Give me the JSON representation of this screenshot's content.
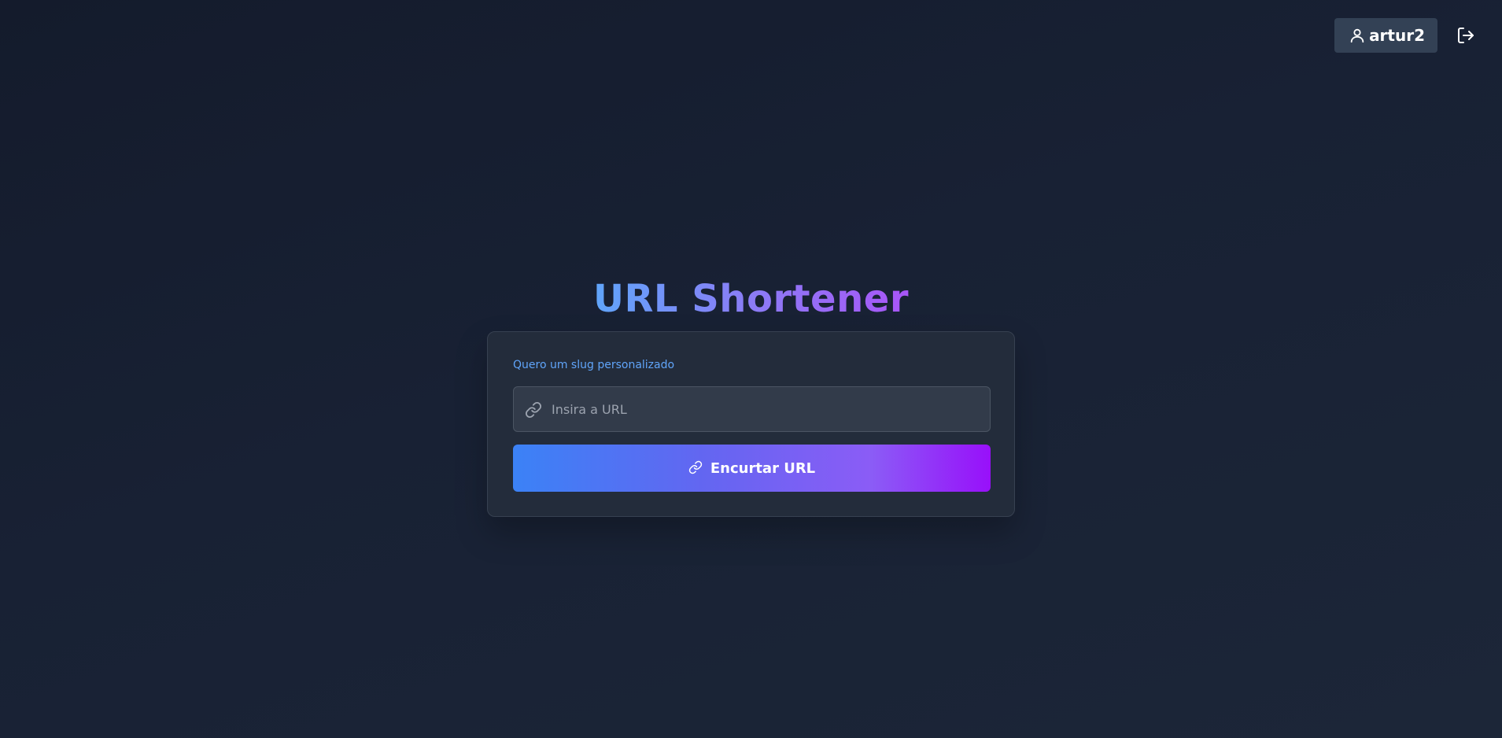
{
  "header": {
    "username": "artur2",
    "user_icon": "user-icon",
    "logout_icon": "logout-icon"
  },
  "main": {
    "title": "URL Shortener",
    "custom_slug_link": "Quero um slug personalizado",
    "url_input": {
      "value": "",
      "placeholder": "Insira a URL",
      "icon": "link-icon"
    },
    "submit_button": {
      "label": "Encurtar URL",
      "icon": "link-icon"
    }
  },
  "colors": {
    "accent_blue": "#60a5fa",
    "accent_purple": "#a855f7",
    "button_gradient_start": "#3b82f6",
    "button_gradient_end": "#9810fa",
    "card_background": "#232c3b",
    "user_chip_background": "#334155"
  }
}
